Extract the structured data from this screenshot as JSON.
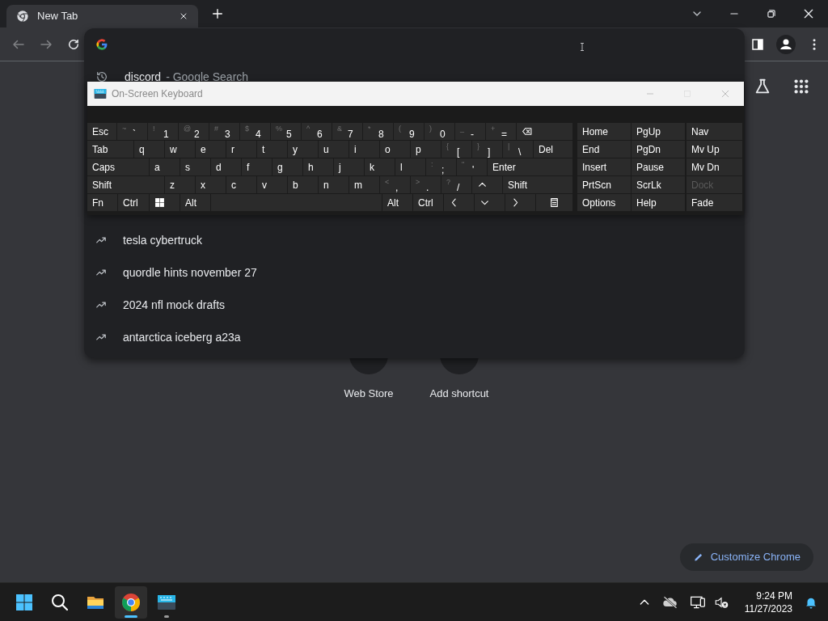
{
  "browser": {
    "tab": {
      "title": "New Tab",
      "selected": true
    }
  },
  "omnibox": {
    "history": [
      {
        "query": "discord",
        "suffix": "- Google Search"
      }
    ],
    "suggestions": [
      {
        "text": "tesla cybertruck"
      },
      {
        "text": "quordle hints november 27"
      },
      {
        "text": "2024 nfl mock drafts"
      },
      {
        "text": "antarctica iceberg a23a"
      }
    ]
  },
  "keyboard": {
    "title": "On-Screen Keyboard",
    "rows": [
      [
        {
          "kind": "text",
          "label": "Esc"
        },
        {
          "kind": "dual",
          "shift": "~",
          "label": "`"
        },
        {
          "kind": "dual",
          "shift": "!",
          "label": "1"
        },
        {
          "kind": "dual",
          "shift": "@",
          "label": "2"
        },
        {
          "kind": "dual",
          "shift": "#",
          "label": "3"
        },
        {
          "kind": "dual",
          "shift": "$",
          "label": "4"
        },
        {
          "kind": "dual",
          "shift": "%",
          "label": "5"
        },
        {
          "kind": "dual",
          "shift": "^",
          "label": "6"
        },
        {
          "kind": "dual",
          "shift": "&",
          "label": "7"
        },
        {
          "kind": "dual",
          "shift": "*",
          "label": "8"
        },
        {
          "kind": "dual",
          "shift": "(",
          "label": "9"
        },
        {
          "kind": "dual",
          "shift": ")",
          "label": "0"
        },
        {
          "kind": "dual",
          "shift": "_",
          "label": "-"
        },
        {
          "kind": "dual",
          "shift": "+",
          "label": "="
        },
        {
          "kind": "backspace"
        }
      ],
      [
        {
          "kind": "text",
          "label": "Tab"
        },
        {
          "kind": "text",
          "label": "q"
        },
        {
          "kind": "text",
          "label": "w"
        },
        {
          "kind": "text",
          "label": "e"
        },
        {
          "kind": "text",
          "label": "r"
        },
        {
          "kind": "text",
          "label": "t"
        },
        {
          "kind": "text",
          "label": "y"
        },
        {
          "kind": "text",
          "label": "u"
        },
        {
          "kind": "text",
          "label": "i"
        },
        {
          "kind": "text",
          "label": "o"
        },
        {
          "kind": "text",
          "label": "p"
        },
        {
          "kind": "dual",
          "shift": "{",
          "label": "["
        },
        {
          "kind": "dual",
          "shift": "}",
          "label": "]"
        },
        {
          "kind": "dual",
          "shift": "|",
          "label": "\\"
        },
        {
          "kind": "text",
          "label": "Del"
        }
      ],
      [
        {
          "kind": "text",
          "label": "Caps"
        },
        {
          "kind": "text",
          "label": "a"
        },
        {
          "kind": "text",
          "label": "s"
        },
        {
          "kind": "text",
          "label": "d"
        },
        {
          "kind": "text",
          "label": "f"
        },
        {
          "kind": "text",
          "label": "g"
        },
        {
          "kind": "text",
          "label": "h"
        },
        {
          "kind": "text",
          "label": "j"
        },
        {
          "kind": "text",
          "label": "k"
        },
        {
          "kind": "text",
          "label": "l"
        },
        {
          "kind": "dual",
          "shift": ":",
          "label": ";"
        },
        {
          "kind": "dual",
          "shift": "\"",
          "label": "'"
        },
        {
          "kind": "text",
          "label": "Enter"
        }
      ],
      [
        {
          "kind": "text",
          "label": "Shift"
        },
        {
          "kind": "text",
          "label": "z"
        },
        {
          "kind": "text",
          "label": "x"
        },
        {
          "kind": "text",
          "label": "c"
        },
        {
          "kind": "text",
          "label": "v"
        },
        {
          "kind": "text",
          "label": "b"
        },
        {
          "kind": "text",
          "label": "n"
        },
        {
          "kind": "text",
          "label": "m"
        },
        {
          "kind": "dual",
          "shift": "<",
          "label": ","
        },
        {
          "kind": "dual",
          "shift": ">",
          "label": "."
        },
        {
          "kind": "dual",
          "shift": "?",
          "label": "/"
        },
        {
          "kind": "up"
        },
        {
          "kind": "text",
          "label": "Shift"
        }
      ],
      [
        {
          "kind": "text",
          "label": "Fn"
        },
        {
          "kind": "text",
          "label": "Ctrl"
        },
        {
          "kind": "windows"
        },
        {
          "kind": "text",
          "label": "Alt"
        },
        {
          "kind": "space"
        },
        {
          "kind": "text",
          "label": "Alt"
        },
        {
          "kind": "text",
          "label": "Ctrl"
        },
        {
          "kind": "left"
        },
        {
          "kind": "down"
        },
        {
          "kind": "right"
        },
        {
          "kind": "menu"
        }
      ]
    ],
    "side_keys": [
      [
        {
          "label": "Home",
          "disabled": false
        },
        {
          "label": "PgUp",
          "disabled": false
        },
        {
          "label": "Nav",
          "disabled": false
        }
      ],
      [
        {
          "label": "End",
          "disabled": false
        },
        {
          "label": "PgDn",
          "disabled": false
        },
        {
          "label": "Mv Up",
          "disabled": false
        }
      ],
      [
        {
          "label": "Insert",
          "disabled": false
        },
        {
          "label": "Pause",
          "disabled": false
        },
        {
          "label": "Mv Dn",
          "disabled": false
        }
      ],
      [
        {
          "label": "PrtScn",
          "disabled": false
        },
        {
          "label": "ScrLk",
          "disabled": false
        },
        {
          "label": "Dock",
          "disabled": true
        }
      ],
      [
        {
          "label": "Options",
          "disabled": false
        },
        {
          "label": "Help",
          "disabled": false
        },
        {
          "label": "Fade",
          "disabled": false
        }
      ]
    ]
  },
  "shortcuts": [
    {
      "label": "Web Store"
    },
    {
      "label": "Add shortcut"
    }
  ],
  "customize_button": "Customize Chrome",
  "taskbar": {
    "apps": [
      {
        "kind": "start",
        "selected": false,
        "running": false
      },
      {
        "kind": "search",
        "selected": false,
        "running": false
      },
      {
        "kind": "files",
        "selected": false,
        "running": false
      },
      {
        "kind": "browser",
        "selected": true,
        "running": true
      },
      {
        "kind": "keyboard",
        "selected": false,
        "running": true
      }
    ],
    "time": "9:24 PM",
    "date": "11/27/2023"
  }
}
